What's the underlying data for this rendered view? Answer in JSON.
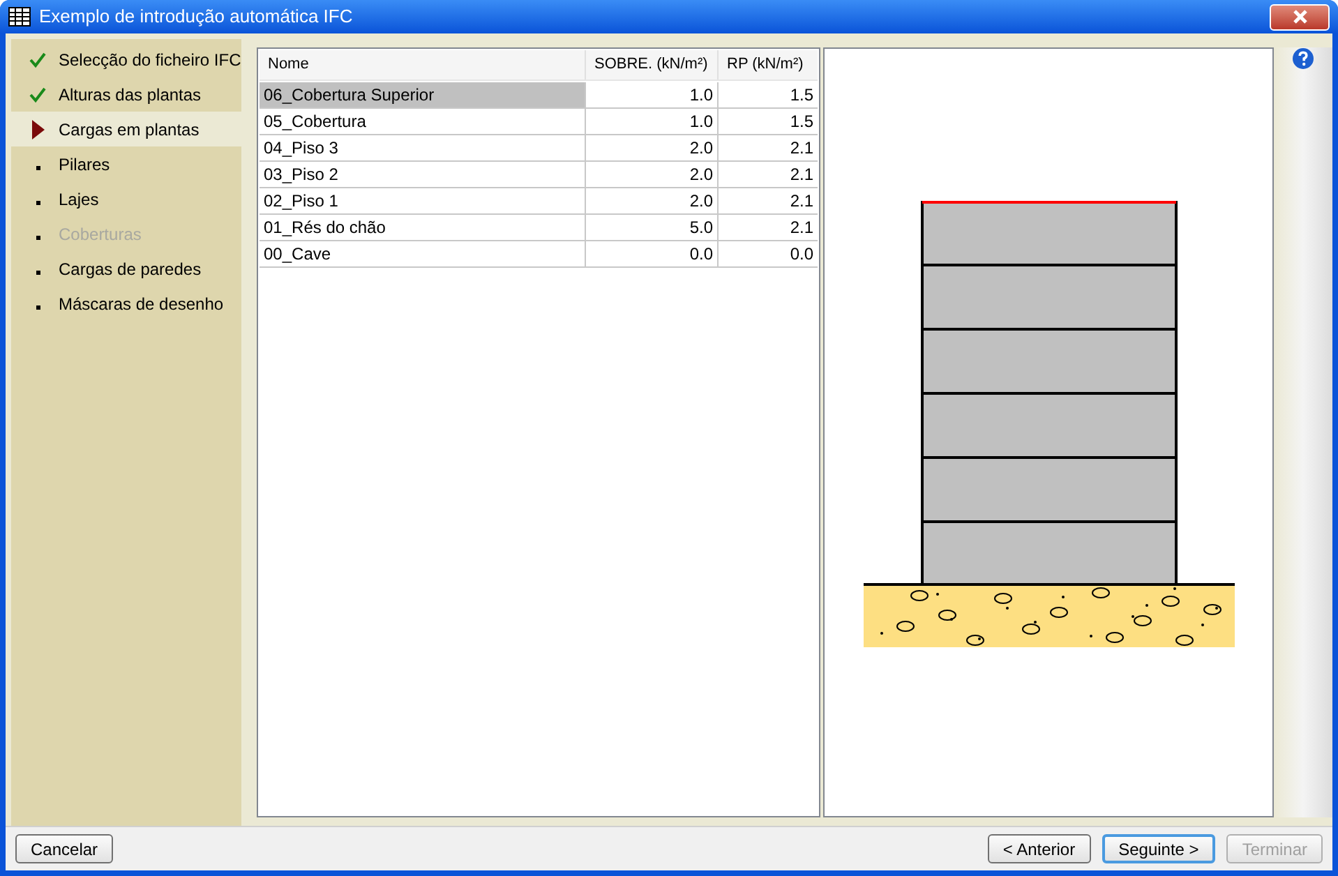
{
  "window": {
    "title": "Exemplo de introdução automática IFC"
  },
  "steps": [
    {
      "label": "Selecção do ficheiro IFC",
      "kind": "done",
      "selected": false,
      "disabled": false
    },
    {
      "label": "Alturas das plantas",
      "kind": "done",
      "selected": false,
      "disabled": false
    },
    {
      "label": "Cargas em plantas",
      "kind": "current",
      "selected": true,
      "disabled": false
    },
    {
      "label": "Pilares",
      "kind": "pending",
      "selected": false,
      "disabled": false
    },
    {
      "label": "Lajes",
      "kind": "pending",
      "selected": false,
      "disabled": false
    },
    {
      "label": "Coberturas",
      "kind": "pending",
      "selected": false,
      "disabled": true
    },
    {
      "label": "Cargas de paredes",
      "kind": "pending",
      "selected": false,
      "disabled": false
    },
    {
      "label": "Máscaras de desenho",
      "kind": "pending",
      "selected": false,
      "disabled": false
    }
  ],
  "table": {
    "columns": [
      "Nome",
      "SOBRE. (kN/m²)",
      "RP (kN/m²)"
    ],
    "rows": [
      {
        "cells": [
          "06_Cobertura Superior",
          "1.0",
          "1.5"
        ],
        "selected": true
      },
      {
        "cells": [
          "05_Cobertura",
          "1.0",
          "1.5"
        ],
        "selected": false
      },
      {
        "cells": [
          "04_Piso 3",
          "2.0",
          "2.1"
        ],
        "selected": false
      },
      {
        "cells": [
          "03_Piso 2",
          "2.0",
          "2.1"
        ],
        "selected": false
      },
      {
        "cells": [
          "02_Piso 1",
          "2.0",
          "2.1"
        ],
        "selected": false
      },
      {
        "cells": [
          "01_Rés do chão",
          "5.0",
          "2.1"
        ],
        "selected": false
      },
      {
        "cells": [
          "00_Cave",
          "0.0",
          "0.0"
        ],
        "selected": false
      }
    ]
  },
  "buttons": [
    {
      "label": "Cancelar",
      "disabled": false,
      "default": false
    },
    {
      "label": "< Anterior",
      "disabled": false,
      "default": false
    },
    {
      "label": "Seguinte >",
      "disabled": false,
      "default": true
    },
    {
      "label": "Terminar",
      "disabled": true,
      "default": false
    }
  ]
}
